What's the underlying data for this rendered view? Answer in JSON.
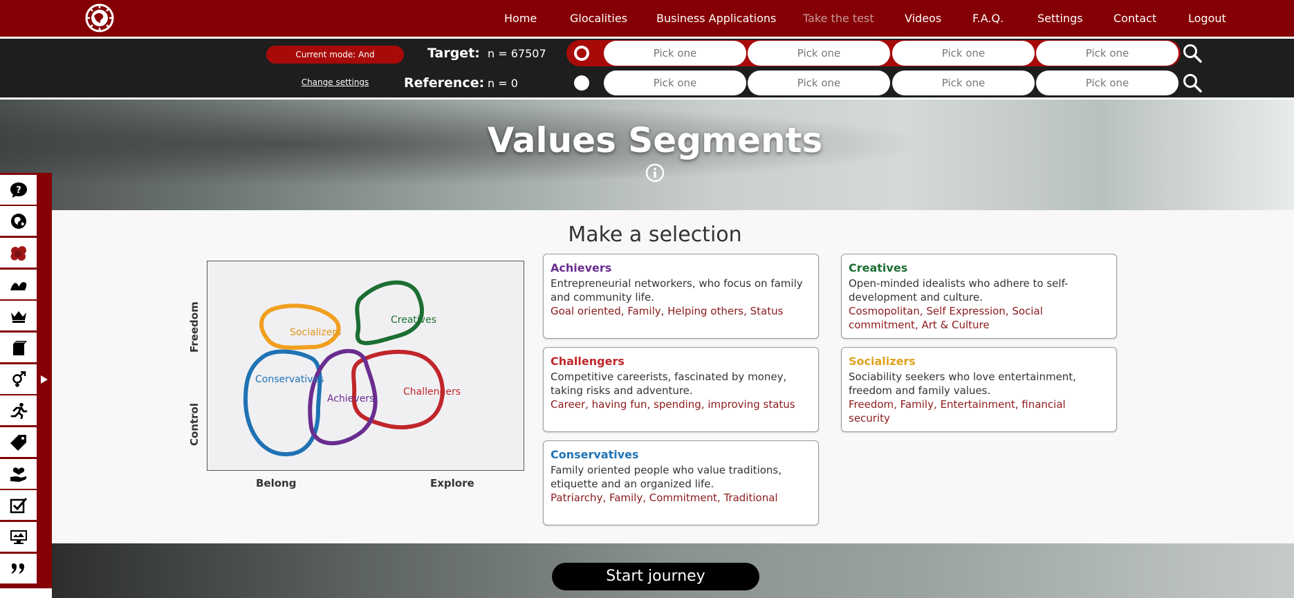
{
  "nav": {
    "items": [
      "Home",
      "Glocalities",
      "Business Applications",
      "Take the test",
      "Videos",
      "F.A.Q.",
      "Settings",
      "Contact",
      "Logout"
    ]
  },
  "filters": {
    "mode_label": "Current mode: And",
    "change_settings": "Change settings",
    "target": {
      "label": "Target:",
      "n": "n = 67507",
      "picks": [
        "Pick one",
        "Pick one",
        "Pick one",
        "Pick one"
      ]
    },
    "reference": {
      "label": "Reference:",
      "n": "n = 0",
      "picks": [
        "Pick one",
        "Pick one",
        "Pick one",
        "Pick one"
      ]
    }
  },
  "hero": {
    "title": "Values Segments"
  },
  "content": {
    "title": "Make a selection",
    "diagram": {
      "y_axis": {
        "top": "Freedom",
        "bottom": "Control"
      },
      "x_axis": {
        "left": "Belong",
        "right": "Explore"
      },
      "segments": [
        {
          "name": "Socializers",
          "color": "#f09f1e"
        },
        {
          "name": "Creatives",
          "color": "#1c6e33"
        },
        {
          "name": "Conservatives",
          "color": "#1f72b4"
        },
        {
          "name": "Achievers",
          "color": "#6a2d8f"
        },
        {
          "name": "Challengers",
          "color": "#c0262a"
        }
      ]
    },
    "cards": [
      {
        "title": "Achievers",
        "color": "#6a2d8f",
        "desc": "Entrepreneurial networkers, who focus on family and community life.",
        "tags": "Goal oriented, Family, Helping others, Status"
      },
      {
        "title": "Creatives",
        "color": "#1c6e33",
        "desc": "Open-minded idealists who adhere to self-development and culture.",
        "tags": "Cosmopolitan, Self Expression, Social commitment, Art & Culture"
      },
      {
        "title": "Challengers",
        "color": "#c0262a",
        "desc": "Competitive careerists, fascinated by money, taking risks and adventure.",
        "tags": "Career, having fun, spending, improving status"
      },
      {
        "title": "Socializers",
        "color": "#e0a21c",
        "desc": "Sociability seekers who love entertainment, freedom and family values.",
        "tags": "Freedom, Family, Entertainment, financial security"
      },
      {
        "title": "Conservatives",
        "color": "#1f72b4",
        "desc": "Family oriented people who value traditions, etiquette and an organized life.",
        "tags": "Patriarchy, Family, Commitment, Traditional"
      }
    ]
  },
  "sidebar": {
    "icons": [
      "question-icon",
      "globe-icon",
      "segments-icon",
      "waves-icon",
      "crown-icon",
      "books-icon",
      "gender-icon",
      "runner-icon",
      "tag-icon",
      "heart-hand-icon",
      "checkbox-icon",
      "monitor-icon",
      "quote-icon"
    ]
  },
  "footer": {
    "button": "Start journey"
  },
  "colors": {
    "brand": "#850004",
    "accent": "#a80a0a",
    "dark": "#1e1e1e"
  }
}
